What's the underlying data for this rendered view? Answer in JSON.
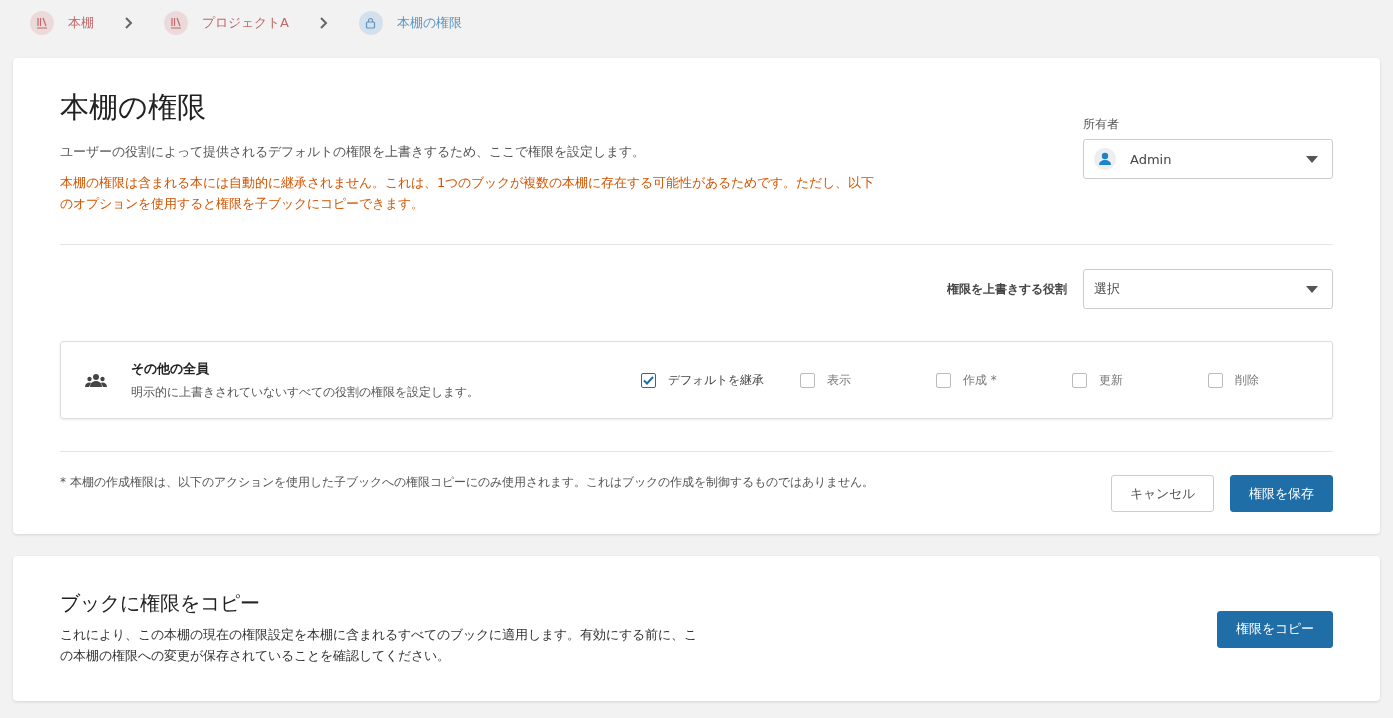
{
  "breadcrumbs": [
    {
      "label": "本棚",
      "kind": "shelf"
    },
    {
      "label": "プロジェクトA",
      "kind": "shelf"
    },
    {
      "label": "本棚の権限",
      "kind": "lock"
    }
  ],
  "permissions_card": {
    "title": "本棚の権限",
    "description": "ユーザーの役割によって提供されるデフォルトの権限を上書きするため、ここで権限を設定します。",
    "warning": "本棚の権限は含まれる本には自動的に継承されません。これは、1つのブックが複数の本棚に存在する可能性があるためです。ただし、以下のオプションを使用すると権限を子ブックにコピーできます。",
    "owner": {
      "label": "所有者",
      "value": "Admin"
    },
    "role_override": {
      "label": "権限を上書きする役割",
      "value": "選択"
    },
    "roles": [
      {
        "name": "その他の全員",
        "description": "明示的に上書きされていないすべての役割の権限を設定します。",
        "options": [
          {
            "label": "デフォルトを継承",
            "checked": true
          },
          {
            "label": "表示",
            "checked": false
          },
          {
            "label": "作成 *",
            "checked": false
          },
          {
            "label": "更新",
            "checked": false
          },
          {
            "label": "削除",
            "checked": false
          }
        ]
      }
    ],
    "footnote": "* 本棚の作成権限は、以下のアクションを使用した子ブックへの権限コピーにのみ使用されます。これはブックの作成を制御するものではありません。",
    "buttons": [
      {
        "label": "キャンセル",
        "kind": "secondary"
      },
      {
        "label": "権限を保存",
        "kind": "primary"
      }
    ]
  },
  "copy_card": {
    "title": "ブックに権限をコピー",
    "description": "これにより、この本棚の現在の権限設定を本棚に含まれるすべてのブックに適用します。有効にする前に、この本棚の権限への変更が保存されていることを確認してください。",
    "button": "権限をコピー"
  }
}
